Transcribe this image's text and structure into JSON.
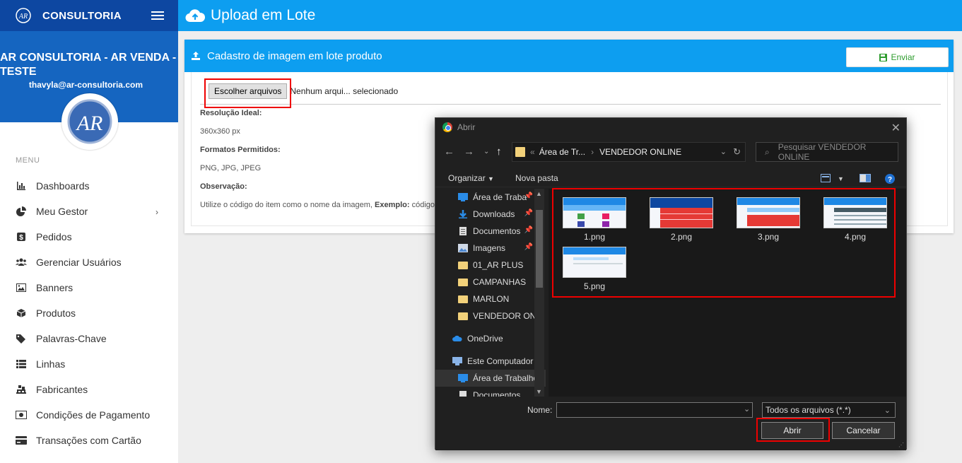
{
  "sidebar": {
    "brand": "CONSULTORIA",
    "company": "AR CONSULTORIA - AR VENDA - TESTE",
    "email": "thavyla@ar-consultoria.com",
    "menu_label": "MENU",
    "items": [
      {
        "label": "Dashboards",
        "icon": "bar-chart-icon"
      },
      {
        "label": "Meu Gestor",
        "icon": "pie-chart-icon"
      },
      {
        "label": "Pedidos",
        "icon": "dollar-icon"
      },
      {
        "label": "Gerenciar Usuários",
        "icon": "users-icon"
      },
      {
        "label": "Banners",
        "icon": "image-icon"
      },
      {
        "label": "Produtos",
        "icon": "box-icon"
      },
      {
        "label": "Palavras-Chave",
        "icon": "tags-icon"
      },
      {
        "label": "Linhas",
        "icon": "list-icon"
      },
      {
        "label": "Fabricantes",
        "icon": "pallet-icon"
      },
      {
        "label": "Condições de Pagamento",
        "icon": "money-icon"
      },
      {
        "label": "Transações com Cartão",
        "icon": "credit-card-icon"
      }
    ]
  },
  "header": {
    "title": "Upload em Lote"
  },
  "panel": {
    "title": "Cadastro de imagem em lote produto",
    "send_label": "Enviar",
    "file_button": "Escolher arquivos",
    "file_status": "Nenhum arqui... selecionado",
    "res_label": "Resolução Ideal:",
    "res_value": "360x360 px",
    "formats_label": "Formatos Permitidos:",
    "formats_value": "PNG, JPG, JPEG",
    "obs_label": "Observação:",
    "obs_text": "Utilize o código do item como o nome da imagem,",
    "obs_example_label": "Exemplo:",
    "obs_example_text": "código d"
  },
  "dialog": {
    "title": "Abrir",
    "path_prefix": "Área de Tr...",
    "path_current": "VENDEDOR ONLINE",
    "search_placeholder": "Pesquisar VENDEDOR ONLINE",
    "organize": "Organizar",
    "new_folder": "Nova pasta",
    "tree": [
      {
        "label": "Área de Traba",
        "pinned": true,
        "icon": "desktop-icon"
      },
      {
        "label": "Downloads",
        "pinned": true,
        "icon": "download-icon"
      },
      {
        "label": "Documentos",
        "pinned": true,
        "icon": "document-icon"
      },
      {
        "label": "Imagens",
        "pinned": true,
        "icon": "pictures-icon"
      },
      {
        "label": "01_AR PLUS",
        "pinned": false,
        "icon": "folder-icon"
      },
      {
        "label": "CAMPANHAS",
        "pinned": false,
        "icon": "folder-icon"
      },
      {
        "label": "MARLON",
        "pinned": false,
        "icon": "folder-icon"
      },
      {
        "label": "VENDEDOR ONL",
        "pinned": false,
        "icon": "folder-icon"
      },
      {
        "label": "OneDrive",
        "pinned": false,
        "icon": "cloud-icon"
      },
      {
        "label": "Este Computador",
        "pinned": false,
        "icon": "computer-icon"
      },
      {
        "label": "Área de Trabalho",
        "pinned": false,
        "icon": "desktop-icon"
      },
      {
        "label": "Documentos",
        "pinned": false,
        "icon": "document-icon"
      }
    ],
    "files": [
      "1.png",
      "2.png",
      "3.png",
      "4.png",
      "5.png"
    ],
    "name_label": "Nome:",
    "name_value": "",
    "file_type": "Todos os arquivos (*.*)",
    "open_label": "Abrir",
    "cancel_label": "Cancelar"
  },
  "colors": {
    "sidebar_dark": "#0d47a1",
    "sidebar_profile": "#1565c0",
    "header_blue": "#0d9ef0",
    "send_green": "#2e9c2e",
    "highlight_red": "#ee0000"
  }
}
